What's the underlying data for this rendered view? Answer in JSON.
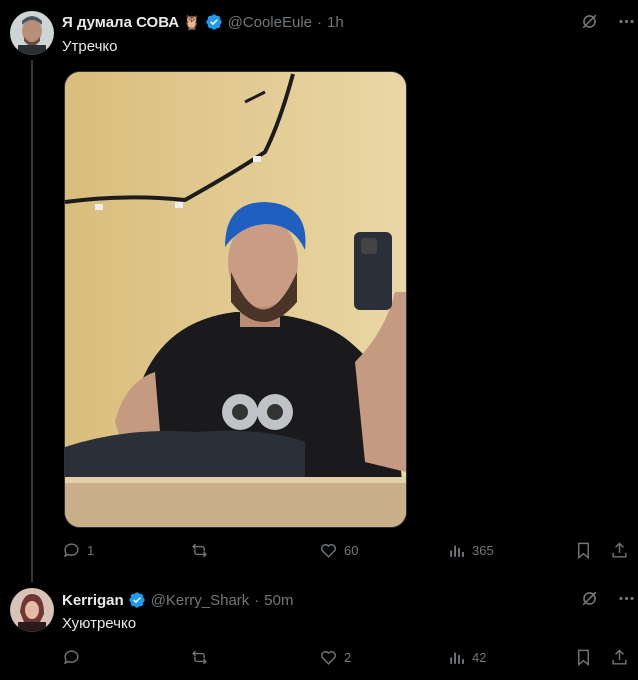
{
  "tweet1": {
    "author_name": "Я думала СОВА",
    "emoji": "🦉",
    "handle": "@CooleEule",
    "time": "1h",
    "text": "Утречко",
    "stats": {
      "replies": "1",
      "retweets": "",
      "likes": "60",
      "views": "365"
    }
  },
  "tweet2": {
    "author_name": "Kerrigan",
    "handle": "@Kerry_Shark",
    "time": "50m",
    "text": "Хуютречко",
    "stats": {
      "replies": "",
      "retweets": "",
      "likes": "2",
      "views": "42"
    }
  },
  "separator": "·",
  "colors": {
    "verified": "#1d9bf0",
    "muted": "#71767b",
    "text": "#e7e9ea",
    "bg": "#000000"
  },
  "icons": [
    "grok-icon",
    "more-icon",
    "reply-icon",
    "retweet-icon",
    "like-icon",
    "views-icon",
    "bookmark-icon",
    "share-icon",
    "verified-icon"
  ]
}
